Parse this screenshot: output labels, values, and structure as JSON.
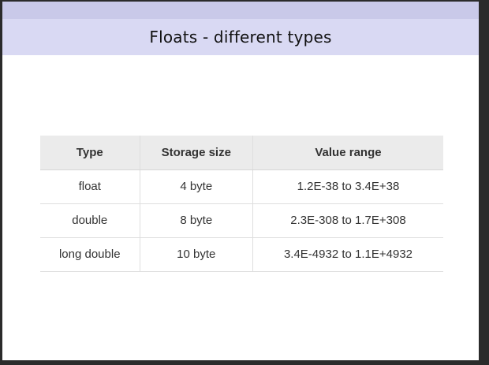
{
  "slide": {
    "title": "Floats - different types"
  },
  "table": {
    "headers": [
      "Type",
      "Storage size",
      "Value range"
    ],
    "rows": [
      [
        "float",
        "4 byte",
        "1.2E-38 to 3.4E+38"
      ],
      [
        "double",
        "8 byte",
        "2.3E-308 to 1.7E+308"
      ],
      [
        "long double",
        "10 byte",
        "3.4E-4932 to 1.1E+4932"
      ]
    ]
  },
  "colors": {
    "title_band": "#d9d9f3",
    "top_band": "#c9c9e9",
    "header_row": "#ebebeb",
    "frame": "#2b2b2b"
  }
}
